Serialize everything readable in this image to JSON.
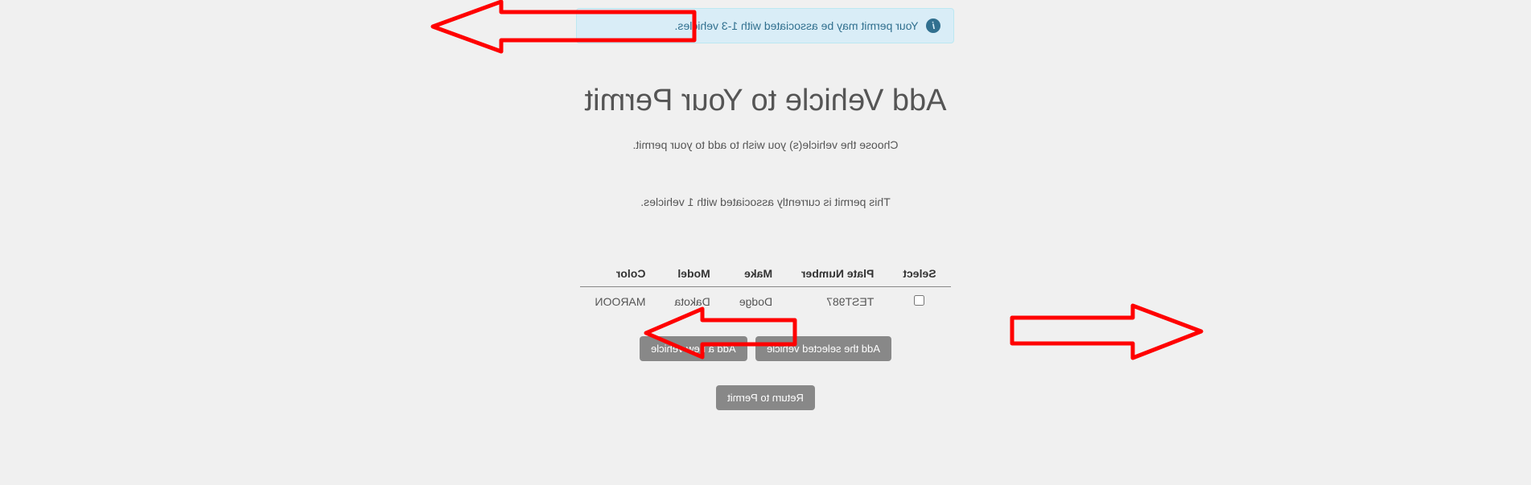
{
  "banner": {
    "text": "Your permit may be associated with 1-3 vehicles."
  },
  "page": {
    "title": "Add Vehicle to Your Permit",
    "subtitle": "Choose the vehicle(s) you wish to add to your permit.",
    "status": "This permit is currently associated with 1 vehicles."
  },
  "table": {
    "headers": {
      "select": "Select",
      "plate": "Plate Number",
      "make": "Make",
      "model": "Model",
      "color": "Color"
    },
    "rows": [
      {
        "plate": "TEST987",
        "make": "Dodge",
        "model": "Dakota",
        "color": "MAROON"
      }
    ]
  },
  "buttons": {
    "add_selected": "Add the selected vehicle",
    "add_new": "Add a new vehicle",
    "return": "Return to Permit"
  }
}
